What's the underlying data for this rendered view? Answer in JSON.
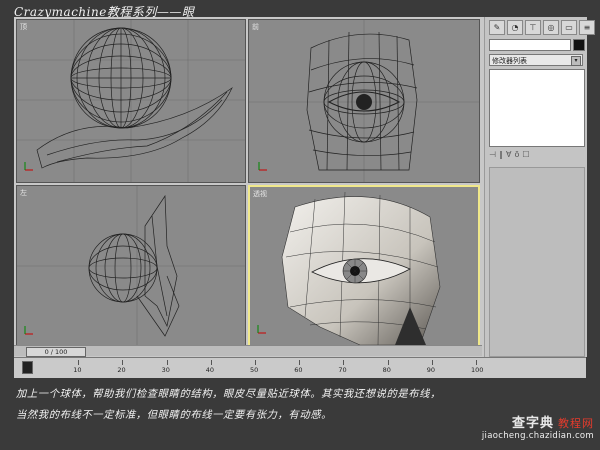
{
  "header": {
    "title": "Crazymachine教程系列——眼"
  },
  "viewports": [
    {
      "label": "顶",
      "active": false
    },
    {
      "label": "前",
      "active": false
    },
    {
      "label": "左",
      "active": false
    },
    {
      "label": "透视",
      "active": true
    }
  ],
  "command_panel": {
    "tab_icons": [
      "create-icon",
      "modify-icon",
      "hierarchy-icon",
      "motion-icon",
      "display-icon",
      "utilities-icon"
    ],
    "modifier_list_label": "修改器列表",
    "name_field_value": "",
    "object_color": "#111111"
  },
  "timeline": {
    "slider_label": "0 / 100",
    "ticks": [
      "10",
      "20",
      "30",
      "40",
      "50",
      "60",
      "70",
      "80",
      "90",
      "100"
    ]
  },
  "caption": {
    "line1": "加上一个球体，帮助我们检查眼睛的结构，眼皮尽量贴近球体。其实我还想说的是布线，",
    "line2": "当然我的布线不一定标准，但眼睛的布线一定要有张力，有动感。"
  },
  "watermark": {
    "brand": "查字典",
    "tag": "教程网",
    "url": "jiaocheng.chazidian.com"
  },
  "colors": {
    "background": "#3a3a3a",
    "viewport": "#8a8a8a",
    "active_border": "#f0e88a"
  }
}
